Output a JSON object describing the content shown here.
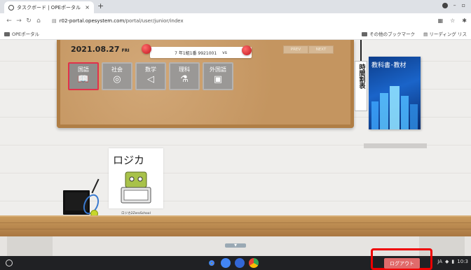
{
  "browser": {
    "tab_title": "タスクボード | OPEポータル",
    "tab_close": "×",
    "new_tab": "+",
    "url_host": "r02-portal.opesystem.com",
    "url_path": "/portal/user/junior/index",
    "bookmark_left": "OPEポータル",
    "bookmark_other": "その他のブックマーク",
    "bookmark_reading": "リーディング リス"
  },
  "board": {
    "date": "2021.08.27",
    "weekday": "FRI",
    "class_label": "7 年1組1番 9921001",
    "class_suffix": "vs",
    "prev": "PREV",
    "next": "NEXT",
    "subjects": [
      {
        "label": "国語",
        "icon": "book-icon"
      },
      {
        "label": "社会",
        "icon": "globe-icon"
      },
      {
        "label": "数学",
        "icon": "ruler-icon"
      },
      {
        "label": "理科",
        "icon": "flask-icon"
      },
      {
        "label": "外国語",
        "icon": "language-icon"
      }
    ],
    "schedule": "時間割表",
    "textbook": "教科書･教材"
  },
  "avatar": {
    "caption": "ロジカ2ZeroSchool"
  },
  "taskbar": {
    "logout": "ログアウト",
    "ime": "JA",
    "time": "10:3"
  },
  "colors": {
    "board": "#c79a62",
    "active_border": "#e1324b",
    "logout_bg": "#e06b6b",
    "highlight": "#e00000"
  }
}
